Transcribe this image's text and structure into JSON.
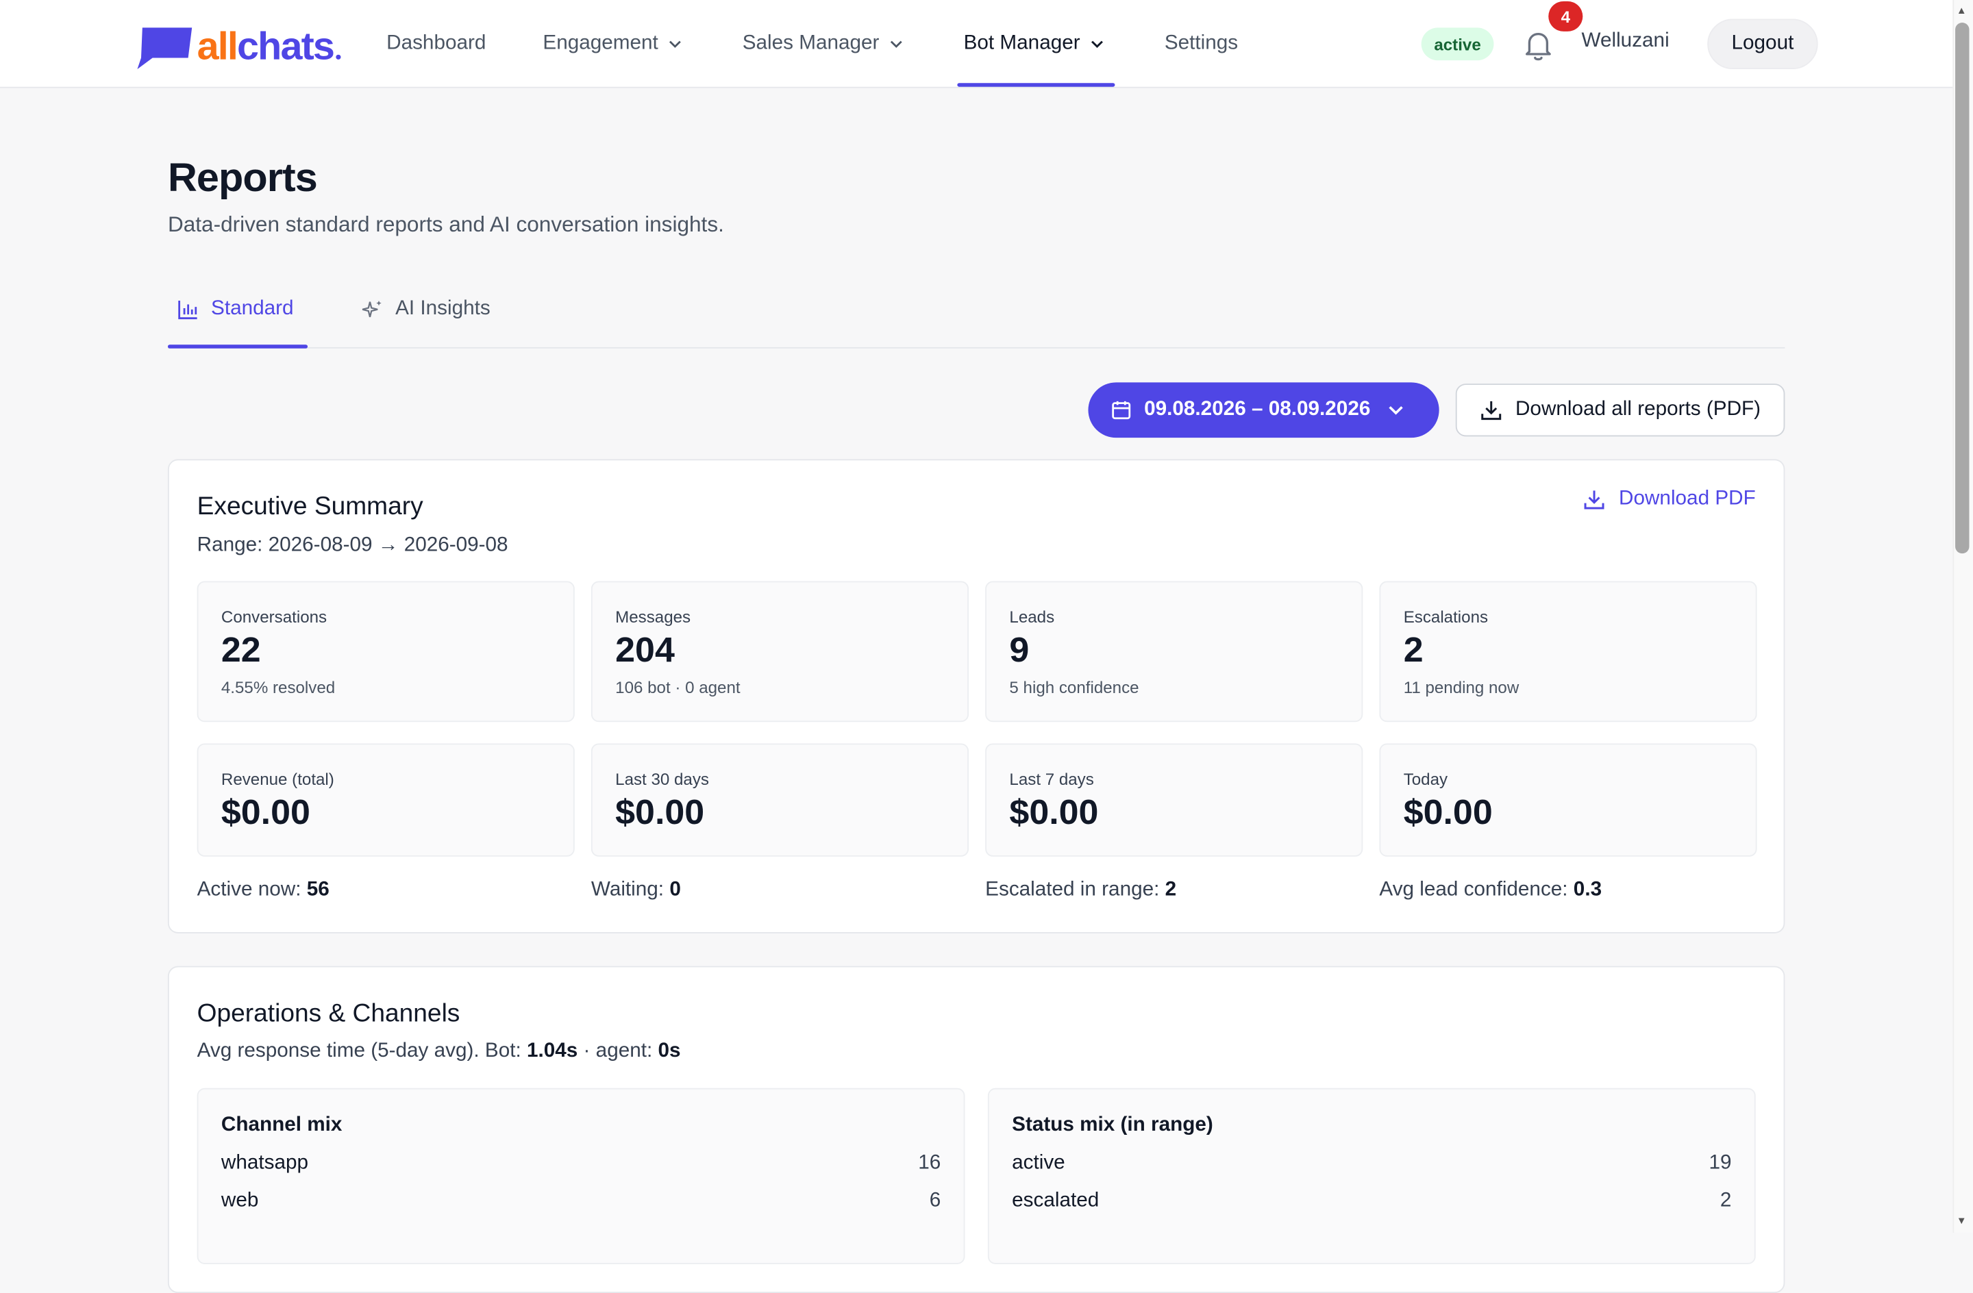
{
  "brand": {
    "logo_part1": "all",
    "logo_part2": "chats",
    "logo_dot": "●",
    "color": "#4f46e5",
    "accent": "#f97316"
  },
  "nav": {
    "items": [
      {
        "label": "Dashboard",
        "has_dropdown": false
      },
      {
        "label": "Engagement",
        "has_dropdown": true
      },
      {
        "label": "Sales Manager",
        "has_dropdown": true
      },
      {
        "label": "Bot Manager",
        "has_dropdown": true,
        "active": true
      },
      {
        "label": "Settings",
        "has_dropdown": false
      }
    ]
  },
  "header_right": {
    "status": "active",
    "notifications_count": "4",
    "username": "Welluzani",
    "logout_label": "Logout"
  },
  "page": {
    "title": "Reports",
    "subtitle": "Data-driven standard reports and AI conversation insights."
  },
  "tabs": [
    {
      "label": "Standard",
      "icon": "bar-chart-icon",
      "active": true
    },
    {
      "label": "AI Insights",
      "icon": "sparkles-icon",
      "active": false
    }
  ],
  "toolbar": {
    "date_range": "09.08.2026 – 08.09.2026",
    "download_all_label": "Download all reports (PDF)"
  },
  "executive_summary": {
    "title": "Executive Summary",
    "range_label": "Range: 2026-08-09 → 2026-09-08",
    "download_label": "Download PDF",
    "stats": [
      {
        "label": "Conversations",
        "value": "22",
        "note": "4.55% resolved"
      },
      {
        "label": "Messages",
        "value": "204",
        "note": "106 bot · 0 agent"
      },
      {
        "label": "Leads",
        "value": "9",
        "note": "5 high confidence"
      },
      {
        "label": "Escalations",
        "value": "2",
        "note": "11 pending now"
      }
    ],
    "revenue": [
      {
        "label": "Revenue (total)",
        "value": "$0.00"
      },
      {
        "label": "Last 30 days",
        "value": "$0.00"
      },
      {
        "label": "Last 7 days",
        "value": "$0.00"
      },
      {
        "label": "Today",
        "value": "$0.00"
      }
    ],
    "inline": [
      {
        "label": "Active now: ",
        "value": "56"
      },
      {
        "label": "Waiting: ",
        "value": "0"
      },
      {
        "label": "Escalated in range: ",
        "value": "2"
      },
      {
        "label": "Avg lead confidence: ",
        "value": "0.3"
      }
    ]
  },
  "operations": {
    "title": "Operations & Channels",
    "response_prefix": "Avg response time (5-day avg). Bot: ",
    "bot_time": "1.04s",
    "agent_sep": " · agent: ",
    "agent_time": "0s",
    "channel_mix": {
      "title": "Channel mix",
      "rows": [
        {
          "label": "whatsapp",
          "value": "16"
        },
        {
          "label": "web",
          "value": "6"
        }
      ]
    },
    "status_mix": {
      "title": "Status mix (in range)",
      "rows": [
        {
          "label": "active",
          "value": "19"
        },
        {
          "label": "escalated",
          "value": "2"
        }
      ]
    }
  }
}
